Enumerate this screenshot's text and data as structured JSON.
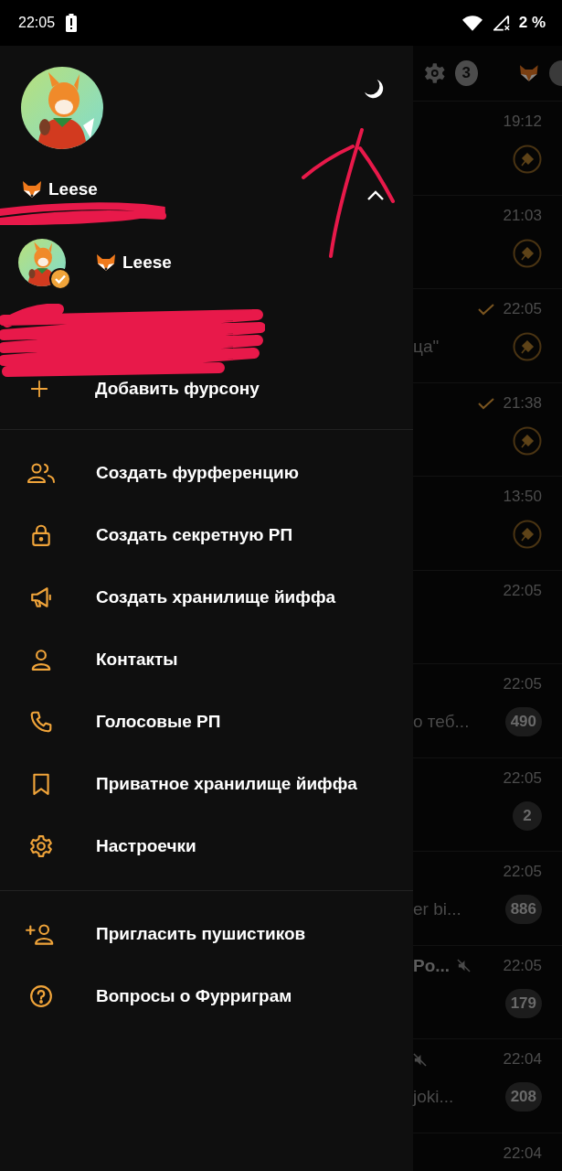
{
  "status_bar": {
    "time": "22:05",
    "battery": "2 %"
  },
  "drawer": {
    "profile": {
      "name": "Leese",
      "accounts_expanded": true
    },
    "accounts": [
      {
        "name": "Leese",
        "selected": true
      }
    ],
    "add_account": "Добавить фурсону",
    "menu": [
      {
        "kind": "group",
        "label": "Создать фурференцию"
      },
      {
        "kind": "lock",
        "label": "Создать секретную РП"
      },
      {
        "kind": "megaphone",
        "label": "Создать хранилище йиффа"
      },
      {
        "kind": "person",
        "label": "Контакты"
      },
      {
        "kind": "phone",
        "label": "Голосовые РП"
      },
      {
        "kind": "bookmark",
        "label": "Приватное хранилище йиффа"
      },
      {
        "kind": "gear",
        "label": "Настроечки"
      }
    ],
    "menu_secondary": [
      {
        "kind": "invite",
        "label": "Пригласить пушистиков"
      },
      {
        "kind": "help",
        "label": "Вопросы о Фурриграм"
      }
    ]
  },
  "chat_list": {
    "header_badge": "3",
    "rows": [
      {
        "time": "19:12",
        "read": false,
        "pinned": true,
        "muted": false
      },
      {
        "time": "21:03",
        "read": false,
        "pinned": true,
        "muted": false
      },
      {
        "time": "22:05",
        "read": true,
        "pinned": true,
        "muted": false,
        "snippet": "ца\""
      },
      {
        "time": "21:38",
        "read": true,
        "pinned": true,
        "muted": false
      },
      {
        "time": "13:50",
        "read": false,
        "pinned": true,
        "muted": false
      },
      {
        "time": "22:05",
        "read": false,
        "pinned": false,
        "muted": false
      },
      {
        "time": "22:05",
        "read": false,
        "pinned": false,
        "muted": false,
        "snippet": "о теб...",
        "badge": "490"
      },
      {
        "time": "22:05",
        "read": false,
        "pinned": false,
        "muted": false,
        "badge": "2"
      },
      {
        "time": "22:05",
        "read": false,
        "pinned": false,
        "muted": false,
        "snippet": "er bi...",
        "badge": "886"
      },
      {
        "time": "22:05",
        "read": false,
        "pinned": false,
        "title": "Po...",
        "muted": true,
        "badge": "179"
      },
      {
        "time": "22:04",
        "read": false,
        "pinned": false,
        "muted": true,
        "snippet": "joki...",
        "badge": "208"
      },
      {
        "time": "22:04",
        "read": false,
        "pinned": false,
        "muted": false
      }
    ]
  }
}
